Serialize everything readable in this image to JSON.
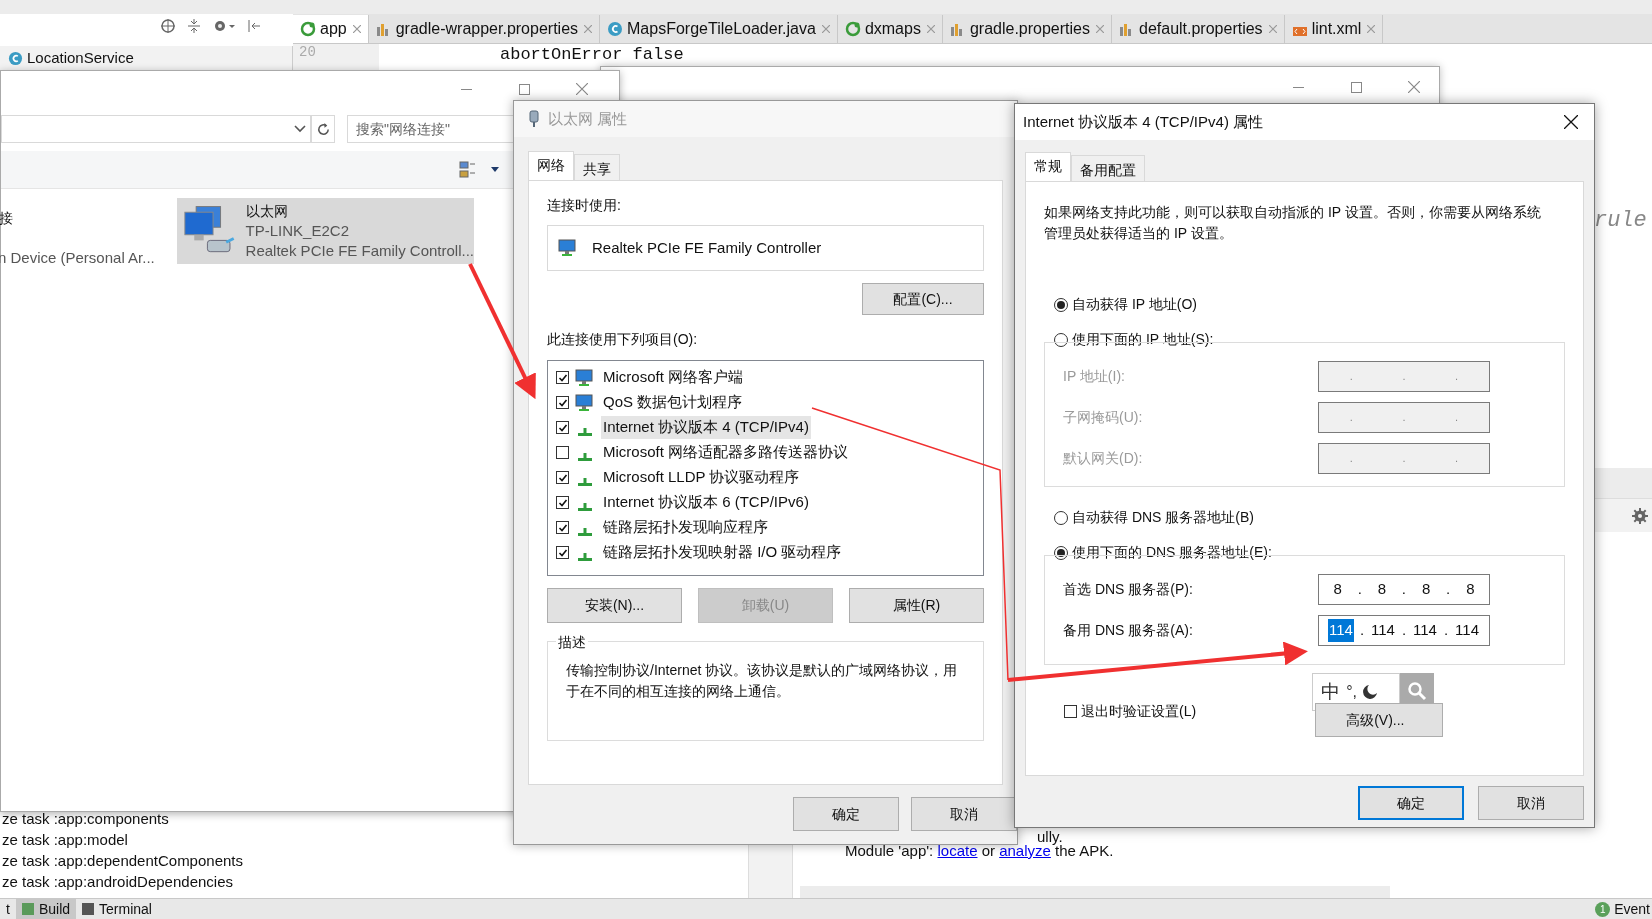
{
  "ide": {
    "editor_tabs": [
      {
        "label": "app",
        "kind": "module",
        "selected": true
      },
      {
        "label": "gradle-wrapper.properties",
        "kind": "properties",
        "selected": false
      },
      {
        "label": "MapsForgeTileLoader.java",
        "kind": "java",
        "selected": false
      },
      {
        "label": "dxmaps",
        "kind": "module",
        "selected": false
      },
      {
        "label": "gradle.properties",
        "kind": "properties",
        "selected": false
      },
      {
        "label": "default.properties",
        "kind": "properties",
        "selected": false
      },
      {
        "label": "lint.xml",
        "kind": "xml",
        "selected": false
      }
    ],
    "structure_item": "LocationService",
    "line_number": "20",
    "code_line": "abortOnError false",
    "side_code": "rule",
    "build_log": [
      "ze task :app:components",
      "ze task :app:model",
      "ze task :app:dependentComponents",
      "ze task :app:androidDependencies"
    ],
    "info_fragment": "ully.",
    "module_line": {
      "prefix": "Module 'app': ",
      "link1": "locate",
      "middle": " or ",
      "link2": "analyze",
      "suffix": " the APK."
    },
    "bottom_tabs": [
      {
        "label": "t",
        "selected": false
      },
      {
        "label": "Build",
        "selected": true
      },
      {
        "label": "Terminal",
        "selected": false
      }
    ],
    "event_badge": "1",
    "event_label": "Event"
  },
  "explorer": {
    "search_placeholder": "搜索\"网络连接\"",
    "left_item": {
      "name": "接",
      "device": "n Device (Personal Ar..."
    },
    "selected_item": {
      "name": "以太网",
      "network": "TP-LINK_E2C2",
      "adapter": "Realtek PCIe FE Family Controll..."
    }
  },
  "ethernet_dialog": {
    "title": "以太网 属性",
    "tabs": [
      {
        "label": "网络",
        "selected": true
      },
      {
        "label": "共享",
        "selected": false
      }
    ],
    "connect_label": "连接时使用:",
    "adapter": "Realtek PCIe FE Family Controller",
    "configure_button": "配置(C)...",
    "items_label": "此连接使用下列项目(O):",
    "items": [
      {
        "label": "Microsoft 网络客户端",
        "kind": "client",
        "checked": true,
        "selected": false
      },
      {
        "label": "QoS 数据包计划程序",
        "kind": "client",
        "checked": true,
        "selected": false
      },
      {
        "label": "Internet 协议版本 4 (TCP/IPv4)",
        "kind": "protocol",
        "checked": true,
        "selected": true
      },
      {
        "label": "Microsoft 网络适配器多路传送器协议",
        "kind": "protocol",
        "checked": false,
        "selected": false
      },
      {
        "label": "Microsoft LLDP 协议驱动程序",
        "kind": "protocol",
        "checked": true,
        "selected": false
      },
      {
        "label": "Internet 协议版本 6 (TCP/IPv6)",
        "kind": "protocol",
        "checked": true,
        "selected": false
      },
      {
        "label": "链路层拓扑发现响应程序",
        "kind": "protocol",
        "checked": true,
        "selected": false
      },
      {
        "label": "链路层拓扑发现映射器 I/O 驱动程序",
        "kind": "protocol",
        "checked": true,
        "selected": false
      }
    ],
    "buttons": [
      {
        "label": "安装(N)...",
        "disabled": false
      },
      {
        "label": "卸载(U)",
        "disabled": true
      },
      {
        "label": "属性(R)",
        "disabled": false
      }
    ],
    "description_label": "描述",
    "description": "传输控制协议/Internet 协议。该协议是默认的广域网络协议，用于在不同的相互连接的网络上通信。",
    "ok": "确定",
    "cancel": "取消"
  },
  "ipv4_dialog": {
    "title": "Internet 协议版本 4 (TCP/IPv4) 属性",
    "tabs": [
      {
        "label": "常规",
        "selected": true
      },
      {
        "label": "备用配置",
        "selected": false
      }
    ],
    "intro": "如果网络支持此功能，则可以获取自动指派的 IP 设置。否则，你需要从网络系统管理员处获得适当的 IP 设置。",
    "separator": ".",
    "ip_options": [
      {
        "label": "自动获得 IP 地址(O)",
        "selected": true
      },
      {
        "label": "使用下面的 IP 地址(S):",
        "selected": false
      }
    ],
    "ip_fields": [
      {
        "label": "IP 地址(I):",
        "disabled": true
      },
      {
        "label": "子网掩码(U):",
        "disabled": true
      },
      {
        "label": "默认网关(D):",
        "disabled": true
      }
    ],
    "dns_options": [
      {
        "label": "自动获得 DNS 服务器地址(B)",
        "selected": false
      },
      {
        "label": "使用下面的 DNS 服务器地址(E):",
        "selected": true
      }
    ],
    "dns_fields": [
      {
        "label": "首选 DNS 服务器(P):",
        "disabled": false,
        "octets": [
          {
            "text": "8",
            "selected": false
          },
          {
            "text": "8",
            "selected": false
          },
          {
            "text": "8",
            "selected": false
          },
          {
            "text": "8",
            "selected": false
          }
        ]
      },
      {
        "label": "备用 DNS 服务器(A):",
        "disabled": false,
        "octets": [
          {
            "text": "114",
            "selected": true
          },
          {
            "text": "114",
            "selected": false
          },
          {
            "text": "114",
            "selected": false
          },
          {
            "text": "114",
            "selected": false
          }
        ]
      }
    ],
    "validate_label": "退出时验证设置(L)",
    "validate_checked": false,
    "ime": {
      "mode": "中",
      "punct": "°,"
    },
    "advanced_button": "高级(V)...",
    "ok": "确定",
    "cancel": "取消"
  }
}
